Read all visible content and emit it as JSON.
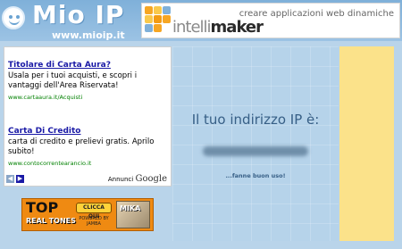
{
  "header": {
    "logo_text": "Mio IP",
    "logo_url": "www.mioip.it",
    "banner_slogan": "creare applicazioni web dinamiche",
    "banner_brand_light": "intelli",
    "banner_brand_bold": "maker",
    "banner_colors": [
      "#f6a623",
      "#f9c94c",
      "#7fb0d9",
      "#f39c12"
    ]
  },
  "ad": {
    "items": [
      {
        "title": "Titolare di Carta Aura?",
        "description": "Usala per i tuoi acquisti, e scopri i vantaggi dell'Area Riservata!",
        "url": "www.cartaaura.it/Acquisti"
      },
      {
        "title": "Carta Di Credito",
        "description": "carta di credito e prelievi gratis. Aprilo subito!",
        "url": "www.contocorrentearancio.it"
      }
    ],
    "prev_icon": "chevron-left-icon",
    "next_icon": "chevron-right-icon",
    "by_label": "Annunci",
    "by_brand": "Google"
  },
  "main": {
    "ip_label": "Il tuo indirizzo IP è:",
    "ip_value": "",
    "note": "...fanne buon uso!"
  },
  "promo": {
    "headline": "TOP",
    "sub": "REAL TONES",
    "button": "CLICCA QUI",
    "powered": "POWERED BY JAMBA",
    "photo_label": "MIKA"
  },
  "colors": {
    "background": "#b9d4ea",
    "right_column": "#fbe28a",
    "link": "#1a1aa6",
    "ad_url": "#008000",
    "text_main": "#375f86",
    "promo": "#ef8a12"
  }
}
